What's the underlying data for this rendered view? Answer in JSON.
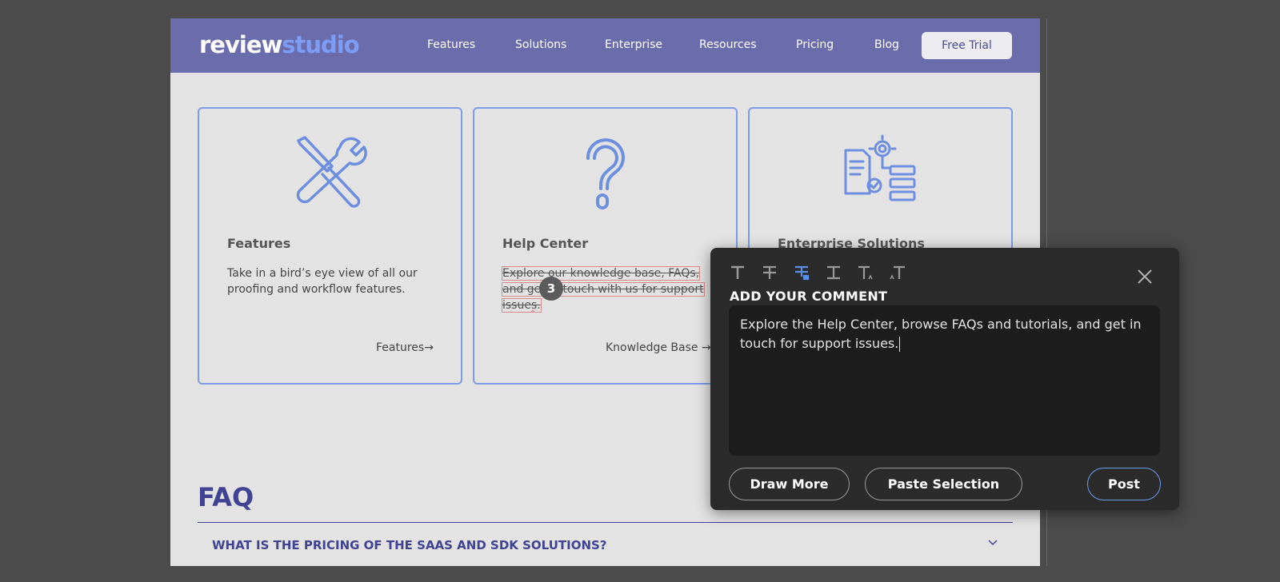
{
  "header": {
    "logo": {
      "part1": "review",
      "part2": "studio"
    },
    "nav": [
      "Features",
      "Solutions",
      "Enterprise",
      "Resources",
      "Pricing",
      "Blog"
    ],
    "cta": "Free Trial"
  },
  "cards": [
    {
      "title": "Features",
      "text": "Take in a bird’s eye view of all our proofing and workflow features.",
      "link": "Features→",
      "icon": "tools-icon"
    },
    {
      "title": "Help Center",
      "text_parts": [
        "Explore our knowledge base, FAQs,",
        "and get in touch with us for support",
        "issues."
      ],
      "link": "Knowledge Base →",
      "icon": "question-icon"
    },
    {
      "title": "Enterprise Solutions",
      "icon": "enterprise-icon"
    }
  ],
  "annotation": {
    "badge": "3"
  },
  "faq": {
    "title": "FAQ",
    "question": "WHAT IS THE PRICING OF THE SAAS AND SDK SOLUTIONS?"
  },
  "popup": {
    "tools": [
      "text-format-icon",
      "strikethrough-icon",
      "replace-text-icon",
      "insert-text-icon",
      "subscript-icon",
      "superscript-icon"
    ],
    "heading": "ADD YOUR COMMENT",
    "comment": "Explore the Help Center, browse FAQs and tutorials, and get in touch for support issues.",
    "buttons": {
      "draw": "Draw More",
      "paste": "Paste Selection",
      "post": "Post"
    }
  },
  "colors": {
    "nav_bg": "#6a6cab",
    "accent": "#7d9df5",
    "faq": "#3f4392",
    "popup_bg": "#2b2b2b",
    "active_tool": "#5b8ee8"
  }
}
